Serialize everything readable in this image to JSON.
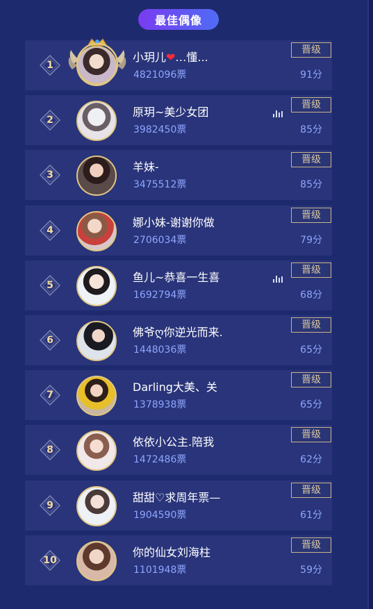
{
  "title": "最佳偶像",
  "promote_label": "晋级",
  "rows": [
    {
      "rank": "1",
      "name": "小玥儿❤…懂...",
      "votes": "4821096票",
      "score": "91分",
      "audio": false,
      "crown": true
    },
    {
      "rank": "2",
      "name": "原玥~美少女团",
      "votes": "3982450票",
      "score": "85分",
      "audio": true,
      "crown": false
    },
    {
      "rank": "3",
      "name": "羊妹-",
      "votes": "3475512票",
      "score": "85分",
      "audio": false,
      "crown": false
    },
    {
      "rank": "4",
      "name": "娜小妹-谢谢你做",
      "votes": "2706034票",
      "score": "79分",
      "audio": false,
      "crown": false
    },
    {
      "rank": "5",
      "name": "鱼儿~恭喜一生喜",
      "votes": "1692794票",
      "score": "68分",
      "audio": true,
      "crown": false
    },
    {
      "rank": "6",
      "name": "佛爷ღ你逆光而来.",
      "votes": "1448036票",
      "score": "65分",
      "audio": false,
      "crown": false
    },
    {
      "rank": "7",
      "name": "Darling大美、关",
      "votes": "1378938票",
      "score": "65分",
      "audio": false,
      "crown": false
    },
    {
      "rank": "8",
      "name": "依依小公主.陪我",
      "votes": "1472486票",
      "score": "62分",
      "audio": false,
      "crown": false
    },
    {
      "rank": "9",
      "name": "甜甜♡求周年票—",
      "votes": "1904590票",
      "score": "61分",
      "audio": false,
      "crown": false
    },
    {
      "rank": "10",
      "name": "你的仙女刘海柱",
      "votes": "1101948票",
      "score": "59分",
      "audio": false,
      "crown": false
    }
  ],
  "colors": {
    "background": "#1e2a6e",
    "row": "#29347a",
    "accent_gold": "#e0c682",
    "votes_blue": "#8fa6ff"
  },
  "icons": {
    "rank_badge": "diamond-rank-badge-icon",
    "audio": "audio-bars-icon",
    "crown": "crown-wings-icon"
  }
}
